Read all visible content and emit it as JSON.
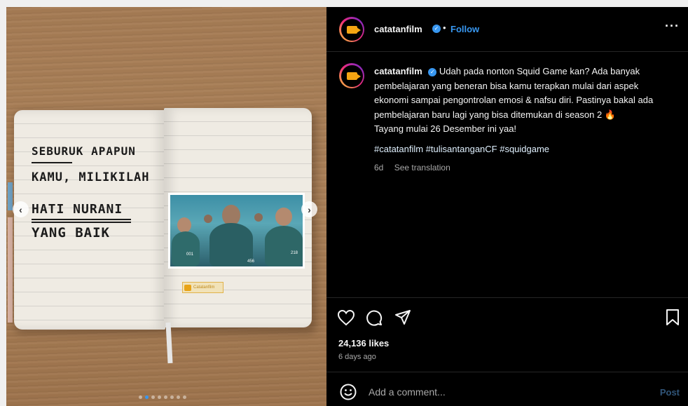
{
  "post": {
    "username": "catatanfilm",
    "follow_label": "Follow",
    "separator": "•",
    "more_label": "···",
    "caption_text": "Udah pada nonton Squid Game kan? Ada banyak pembelajaran yang beneran bisa kamu terapkan mulai dari aspek ekonomi sampai pengontrolan emosi & nafsu diri. Pastinya bakal ada pembelajaran baru lagi yang bisa ditemukan di season 2",
    "caption_emoji": "🔥",
    "caption_text_2": "Tayang mulai 26 Desember ini yaa!",
    "hashtags": "#catatanfilm #tulisantanganCF #squidgame",
    "age_short": "6d",
    "see_translation": "See translation",
    "likes": "24,136 likes",
    "ago": "6 days ago"
  },
  "media": {
    "handwriting": [
      "SEBURUK APAPUN",
      "KAMU, MILIKILAH",
      "HATI NURANI",
      "YANG BAIK"
    ],
    "photo_numbers": [
      "001",
      "456",
      "218"
    ],
    "stamp_text": "Catatanfilm",
    "prev_icon": "chevron-left-icon",
    "next_icon": "chevron-right-icon",
    "carousel": {
      "count": 8,
      "active_index": 1
    }
  },
  "comment": {
    "placeholder": "Add a comment...",
    "post_label": "Post"
  },
  "colors": {
    "accent": "#3897f0",
    "background": "#000000",
    "brand": "#f5a512"
  },
  "icons": [
    "heart-icon",
    "comment-icon",
    "share-icon",
    "bookmark-icon",
    "emoji-icon",
    "verified-icon"
  ]
}
